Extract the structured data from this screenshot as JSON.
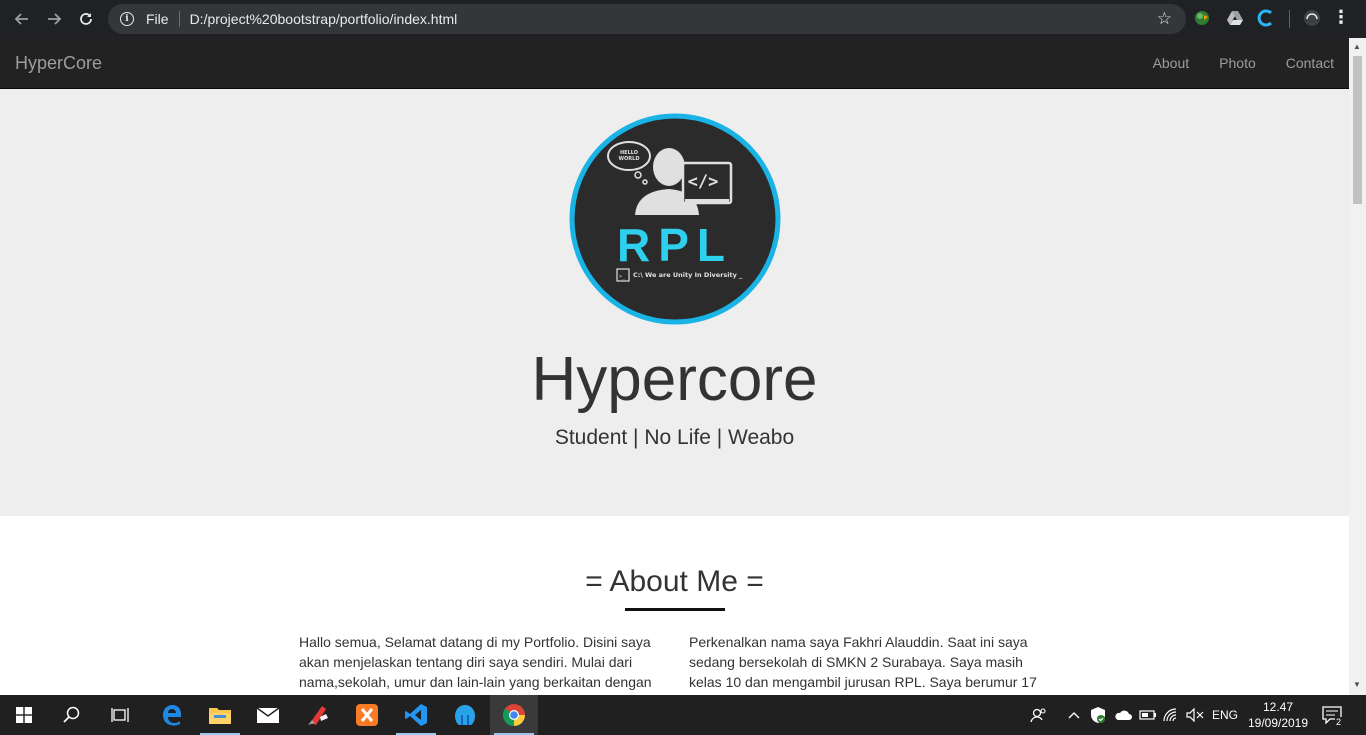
{
  "browser": {
    "protocol_label": "File",
    "url": "D:/project%20bootstrap/portfolio/index.html"
  },
  "site_nav": {
    "brand": "HyperCore",
    "links": [
      "About",
      "Photo",
      "Contact"
    ]
  },
  "hero": {
    "logo_text": {
      "bubble": "HELLO WORLD",
      "code": "</>",
      "big": "RPL",
      "prompt_icon": ">_",
      "tagline": "C:\\ We are Unity In Diversity _"
    },
    "title": "Hypercore",
    "subtitle": "Student | No Life | Weabo"
  },
  "about": {
    "title": "= About Me =",
    "col_left": "Hallo semua, Selamat datang di my Portfolio. Disini saya akan menjelaskan tentang diri saya sendiri. Mulai dari nama,sekolah, umur dan lain-lain yang berkaitan dengan",
    "col_right": "Perkenalkan nama saya Fakhri Alauddin. Saat ini saya sedang bersekolah di SMKN 2 Surabaya. Saya masih kelas 10 dan mengambil jurusan RPL. Saya berumur 17"
  },
  "taskbar": {
    "language": "ENG",
    "time": "12.47",
    "date": "19/09/2019",
    "notification_count": "2"
  },
  "colors": {
    "chrome_bg": "#202124",
    "navbar_bg": "#222222",
    "hero_bg": "#eeeeee",
    "logo_ring": "#1ab3e6",
    "logo_fill": "#2b2b2b",
    "logo_text": "#2fd0ee",
    "taskbar_bg": "#202020"
  }
}
